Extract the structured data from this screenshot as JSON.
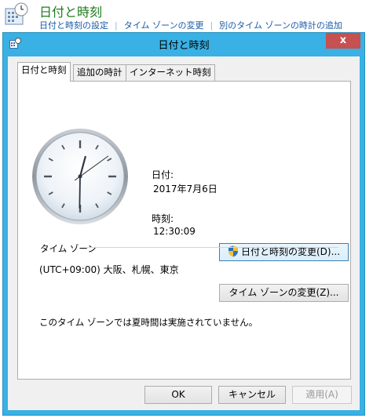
{
  "control_panel": {
    "title": "日付と時刻",
    "links": [
      "日付と時刻の設定",
      "タイム ゾーンの変更",
      "別のタイム ゾーンの時計の追加"
    ]
  },
  "dialog": {
    "title": "日付と時刻",
    "close_label": "x",
    "tabs": [
      "日付と時刻",
      "追加の時計",
      "インターネット時刻"
    ],
    "date_label": "日付:",
    "date_value": "2017年7月6日",
    "time_label": "時刻:",
    "time_value": "12:30:09",
    "change_datetime_button": "日付と時刻の変更(D)...",
    "timezone_group_label": "タイム ゾーン",
    "timezone_value": "(UTC+09:00) 大阪、札幌、東京",
    "change_timezone_button": "タイム ゾーンの変更(Z)...",
    "dst_message": "このタイム ゾーンでは夏時間は実施されていません。",
    "ok_button": "OK",
    "cancel_button": "キャンセル",
    "apply_button": "適用(A)"
  },
  "clock": {
    "hour": 12,
    "minute": 30,
    "second": 9
  },
  "colors": {
    "accent": "#39b1e4",
    "close": "#c75050",
    "title_green": "#1e7b1e",
    "link_blue": "#1a5aa8"
  },
  "icons": [
    "calendar-clock-icon",
    "dialog-app-icon",
    "uac-shield-icon"
  ]
}
